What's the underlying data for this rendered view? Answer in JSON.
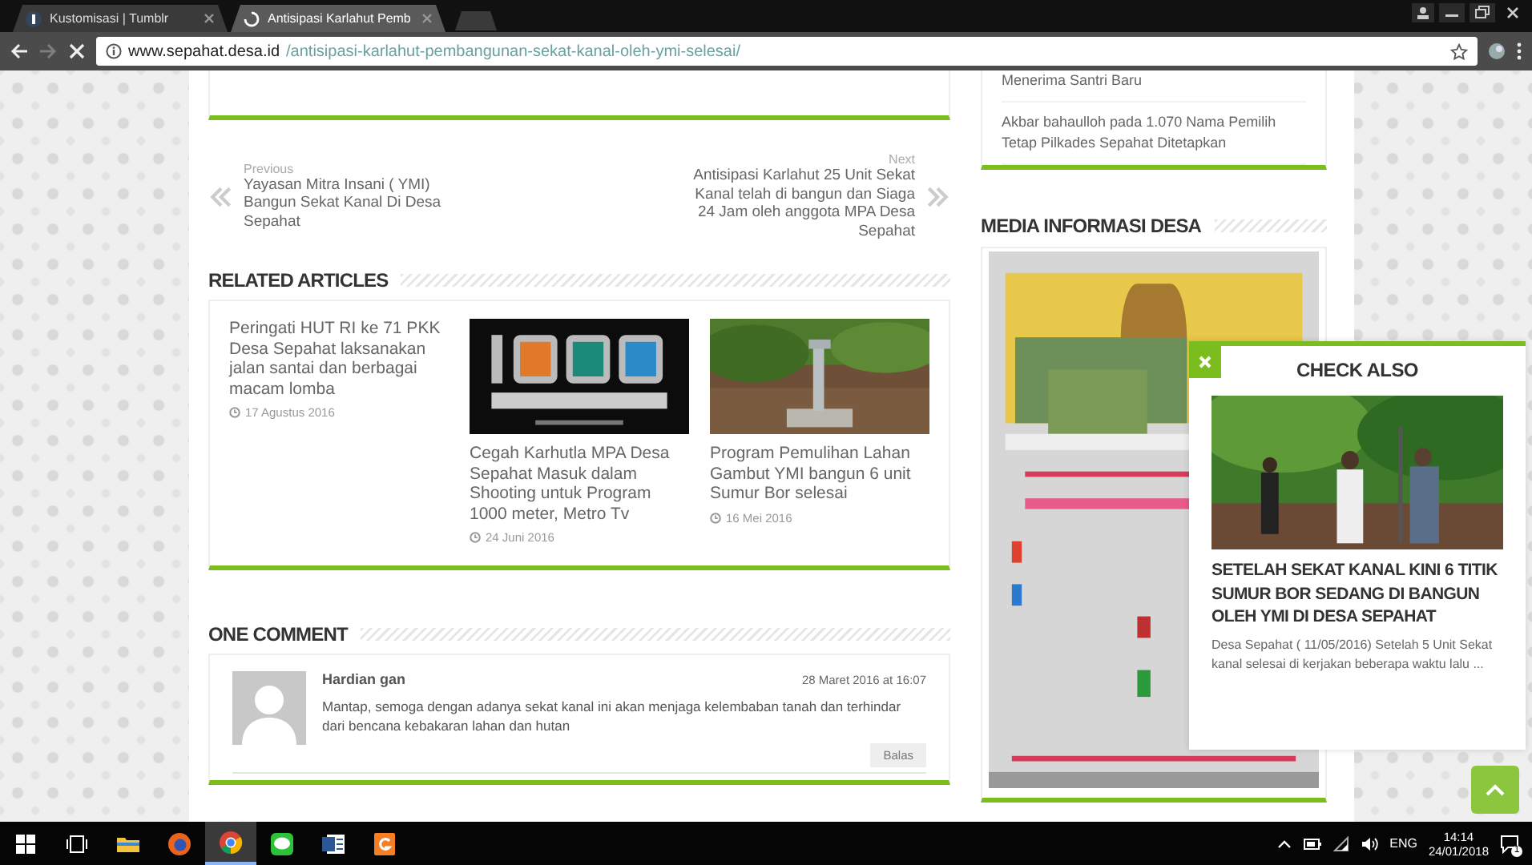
{
  "browser": {
    "tabs": [
      {
        "label": "Kustomisasi | Tumblr",
        "selected": false,
        "loading": false
      },
      {
        "label": "Antisipasi Karlahut Pemb",
        "selected": true,
        "loading": true
      }
    ],
    "forward_disabled": true,
    "url": {
      "host": "www.sepahat.desa.id",
      "path": "/antisipasi-karlahut-pembangunan-sekat-kanal-oleh-ymi-selesai/"
    }
  },
  "post_nav": {
    "previous": {
      "label": "Previous",
      "title": "Yayasan Mitra Insani ( YMI) Bangun Sekat Kanal Di Desa Sepahat"
    },
    "next": {
      "label": "Next",
      "title": "Antisipasi Karlahut 25 Unit Sekat Kanal telah di bangun dan Siaga 24 Jam oleh anggota MPA Desa Sepahat"
    }
  },
  "related": {
    "heading": "RELATED ARTICLES",
    "items": [
      {
        "kind": "text-only",
        "title": "Peringati HUT RI ke 71 PKK Desa Sepahat laksanakan jalan santai dan berbagai macam lomba",
        "date": "17 Agustus 2016"
      },
      {
        "kind": "with-picture",
        "title": "Cegah Karhutla MPA Desa Sepahat Masuk dalam Shooting untuk Program 1000 meter, Metro Tv",
        "date": "24 Juni 2016"
      },
      {
        "kind": "with-picture",
        "title": "Program Pemulihan Lahan Gambut YMI bangun 6 unit Sumur Bor selesai",
        "date": "16 Mei 2016"
      }
    ]
  },
  "comments": {
    "heading": "ONE COMMENT",
    "items": [
      {
        "author": "Hardian gan",
        "date": "28 Maret 2016 at 16:07",
        "text": "Mantap, semoga dengan adanya sekat kanal ini akan menjaga kelembaban tanah dan terhindar dari bencana kebakaran lahan dan hutan",
        "reply": "Balas"
      }
    ]
  },
  "sidebar": {
    "recent_posts": [
      "Menerima Santri Baru",
      "Akbar bahaulloh pada 1.070 Nama Pemilih Tetap Pilkades Sepahat Ditetapkan"
    ],
    "media_heading": "MEDIA INFORMASI DESA",
    "media_image": {
      "kind": "picture"
    }
  },
  "check_also": {
    "heading": "CHECK ALSO",
    "title": "SETELAH SEKAT KANAL KINI 6 TITIK SUMUR BOR SEDANG DI BANGUN OLEH YMI DI DESA SEPAHAT",
    "excerpt": "Desa Sepahat ( 11/05/2016) Setelah 5 Unit Sekat kanal selesai di kerjakan beberapa waktu lalu ..."
  },
  "taskbar": {
    "apps": [
      {
        "kind": "start",
        "selected": false
      },
      {
        "kind": "task-view",
        "selected": false
      },
      {
        "kind": "explorer",
        "selected": false
      },
      {
        "kind": "firefox",
        "selected": false
      },
      {
        "kind": "chrome",
        "selected": true
      },
      {
        "kind": "line",
        "selected": false
      },
      {
        "kind": "word",
        "selected": false
      },
      {
        "kind": "orange-app",
        "selected": false
      }
    ],
    "language": "ENG",
    "time": "14:14",
    "date": "24/01/2018",
    "notification_count": "1"
  }
}
